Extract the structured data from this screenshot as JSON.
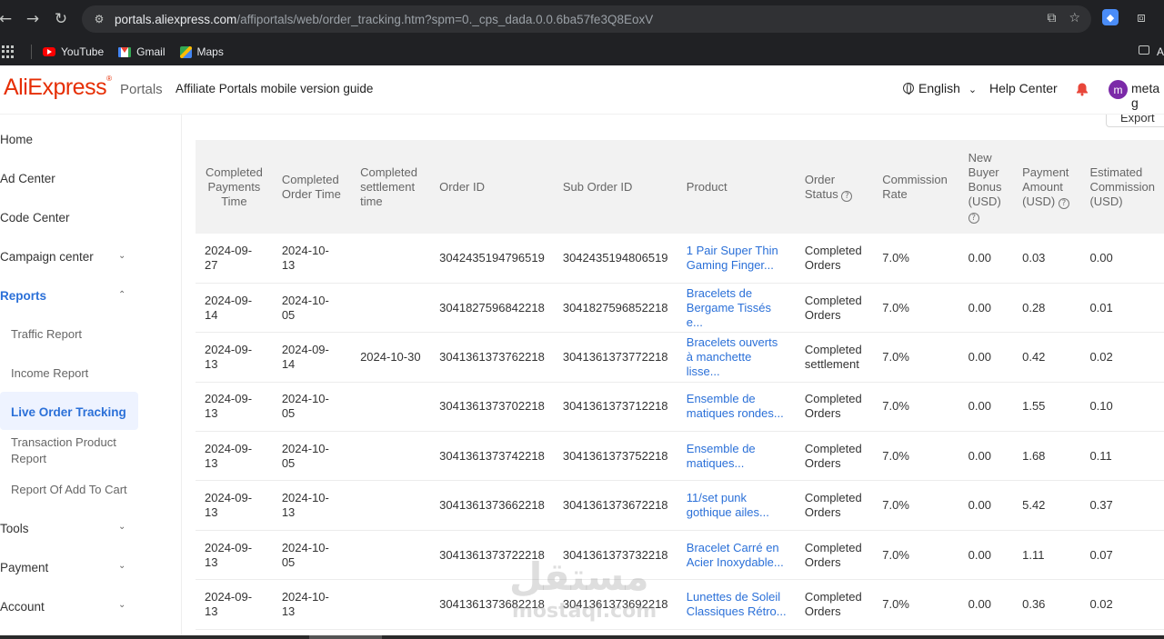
{
  "browser": {
    "url_host": "portals.aliexpress.com",
    "url_path": "/affiportals/web/order_tracking.htm?spm=0._cps_dada.0.0.6ba57fe3Q8EoxV",
    "bookmarks": [
      {
        "label": "YouTube",
        "icon": "youtube-icon"
      },
      {
        "label": "Gmail",
        "icon": "gmail-icon"
      },
      {
        "label": "Maps",
        "icon": "maps-icon"
      }
    ],
    "folder_label": "A"
  },
  "header": {
    "logo": "AliExpress",
    "portals": "Portals",
    "guide": "Affiliate Portals mobile version guide",
    "language": "English",
    "help": "Help Center",
    "avatar_letter": "m",
    "user_name": "meta g"
  },
  "sidebar": {
    "items": [
      {
        "label": "Home"
      },
      {
        "label": "Ad Center"
      },
      {
        "label": "Code Center"
      },
      {
        "label": "Campaign center"
      },
      {
        "label": "Reports"
      },
      {
        "label": "Traffic Report"
      },
      {
        "label": "Income Report"
      },
      {
        "label": "Live Order Tracking"
      },
      {
        "label": "Transaction Product Report"
      },
      {
        "label": "Report Of Add To Cart"
      },
      {
        "label": "Tools"
      },
      {
        "label": "Payment"
      },
      {
        "label": "Account"
      }
    ]
  },
  "main": {
    "export_label": "Export",
    "columns": [
      "Completed Payments Time",
      "Completed Order Time",
      "Completed settlement time",
      "Order ID",
      "Sub Order ID",
      "Product",
      "Order Status",
      "Commission Rate",
      "New Buyer Bonus (USD)",
      "Payment Amount (USD)",
      "Estimated Commission (USD)"
    ],
    "rows": [
      [
        "2024-09-27",
        "2024-10-13",
        "",
        "3042435194796519",
        "3042435194806519",
        "1 Pair Super Thin Gaming Finger...",
        "Completed Orders",
        "7.0%",
        "0.00",
        "0.03",
        "0.00"
      ],
      [
        "2024-09-14",
        "2024-10-05",
        "",
        "3041827596842218",
        "3041827596852218",
        "Bracelets de Bergame Tissés e...",
        "Completed Orders",
        "7.0%",
        "0.00",
        "0.28",
        "0.01"
      ],
      [
        "2024-09-13",
        "2024-09-14",
        "2024-10-30",
        "3041361373762218",
        "3041361373772218",
        "Bracelets ouverts à manchette lisse...",
        "Completed settlement",
        "7.0%",
        "0.00",
        "0.42",
        "0.02"
      ],
      [
        "2024-09-13",
        "2024-10-05",
        "",
        "3041361373702218",
        "3041361373712218",
        "Ensemble de matiques rondes...",
        "Completed Orders",
        "7.0%",
        "0.00",
        "1.55",
        "0.10"
      ],
      [
        "2024-09-13",
        "2024-10-05",
        "",
        "3041361373742218",
        "3041361373752218",
        "Ensemble de matiques...",
        "Completed Orders",
        "7.0%",
        "0.00",
        "1.68",
        "0.11"
      ],
      [
        "2024-09-13",
        "2024-10-13",
        "",
        "3041361373662218",
        "3041361373672218",
        "11/set punk gothique ailes...",
        "Completed Orders",
        "7.0%",
        "0.00",
        "5.42",
        "0.37"
      ],
      [
        "2024-09-13",
        "2024-10-05",
        "",
        "3041361373722218",
        "3041361373732218",
        "Bracelet Carré en Acier Inoxydable...",
        "Completed Orders",
        "7.0%",
        "0.00",
        "1.11",
        "0.07"
      ],
      [
        "2024-09-13",
        "2024-10-13",
        "",
        "3041361373682218",
        "3041361373692218",
        "Lunettes de Soleil Classiques Rétro...",
        "Completed Orders",
        "7.0%",
        "0.00",
        "0.36",
        "0.02"
      ]
    ]
  },
  "watermark": {
    "arabic": "مستقل",
    "latin": "mostaql.com"
  }
}
